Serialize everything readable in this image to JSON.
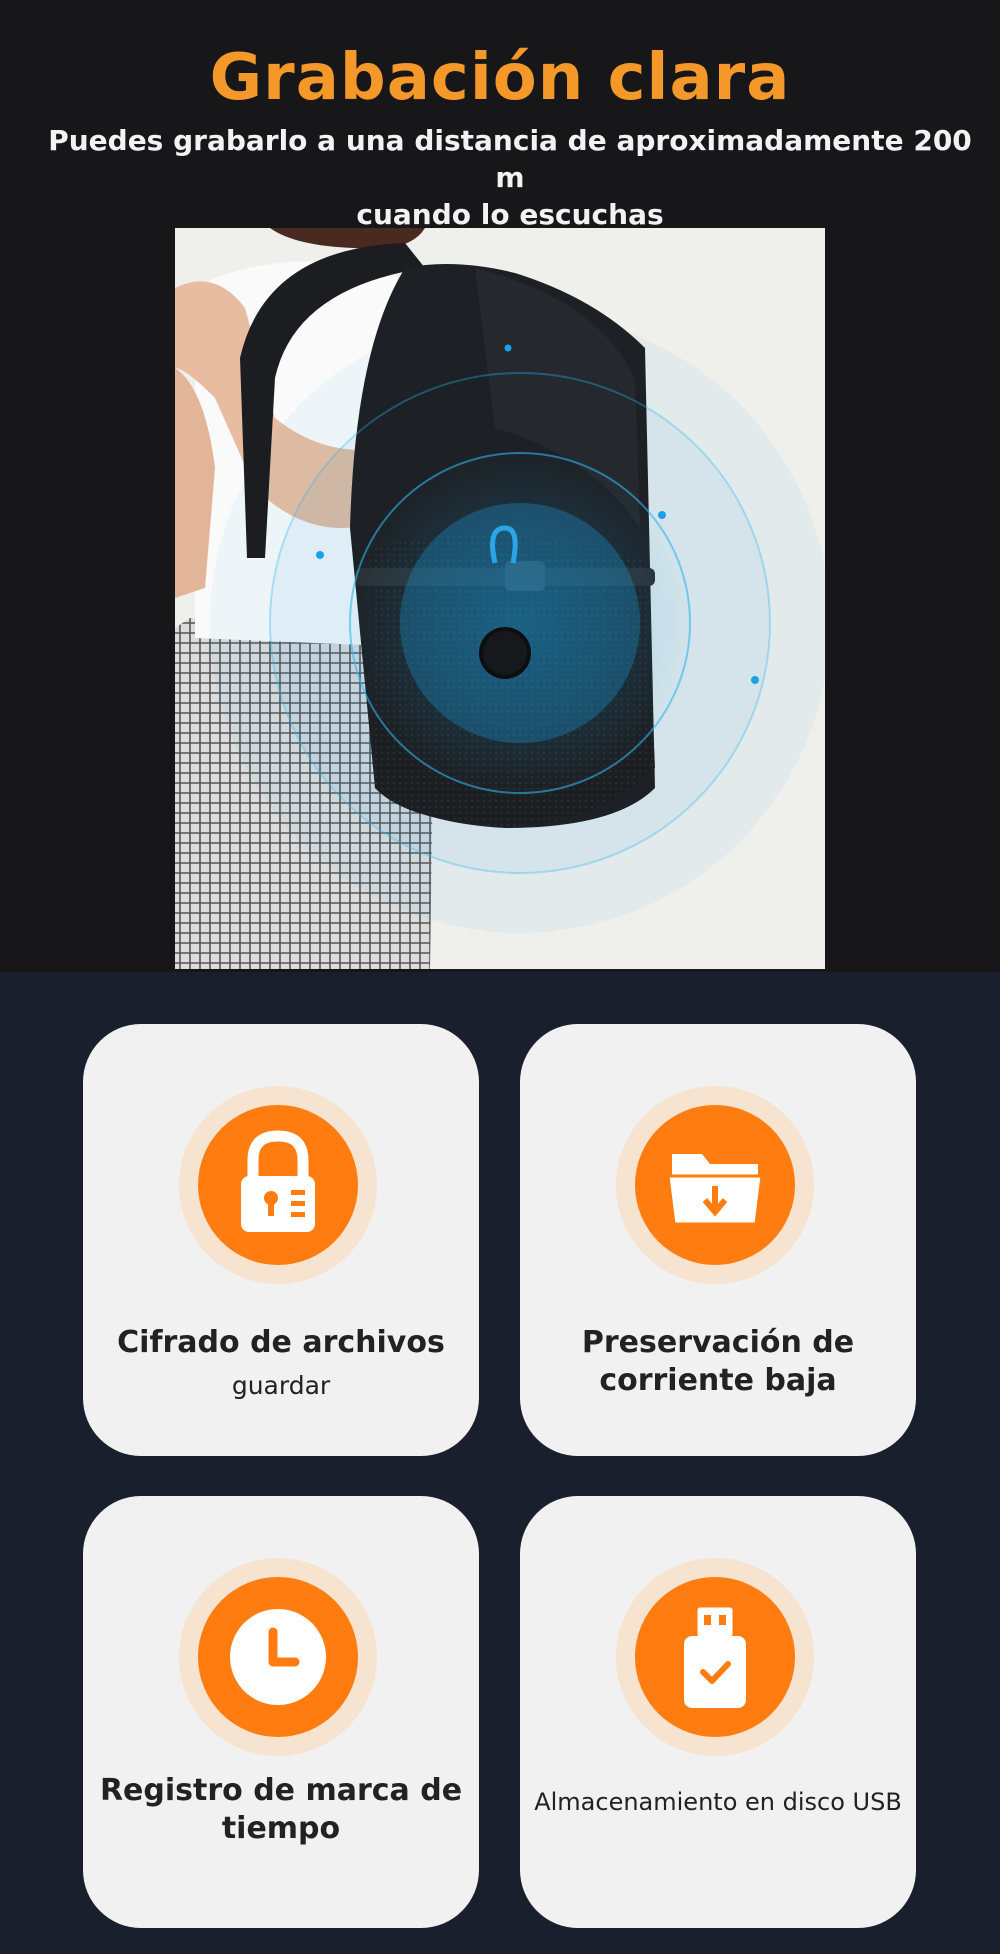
{
  "header": {
    "title": "Grabación clara",
    "subtitle_line1": "Puedes grabarlo a una distancia de aproximadamente 200 m",
    "subtitle_line2": "cuando lo escuchas"
  },
  "colors": {
    "accent": "#f5982a",
    "icon_orange": "#ff7d10",
    "card_bg": "#f1f1f1",
    "page_bottom_bg": "#1a1f2e",
    "wave_blue": "#1aa0e0"
  },
  "features": [
    {
      "icon": "padlock-icon",
      "line1": "Cifrado de archivos",
      "line2": "guardar"
    },
    {
      "icon": "folder-download-icon",
      "line1": "Preservación de",
      "line2": "corriente baja"
    },
    {
      "icon": "clock-icon",
      "line1": "Registro de marca de",
      "line2": "tiempo"
    },
    {
      "icon": "usb-drive-icon",
      "line1": "Almacenamiento en disco USB"
    }
  ]
}
